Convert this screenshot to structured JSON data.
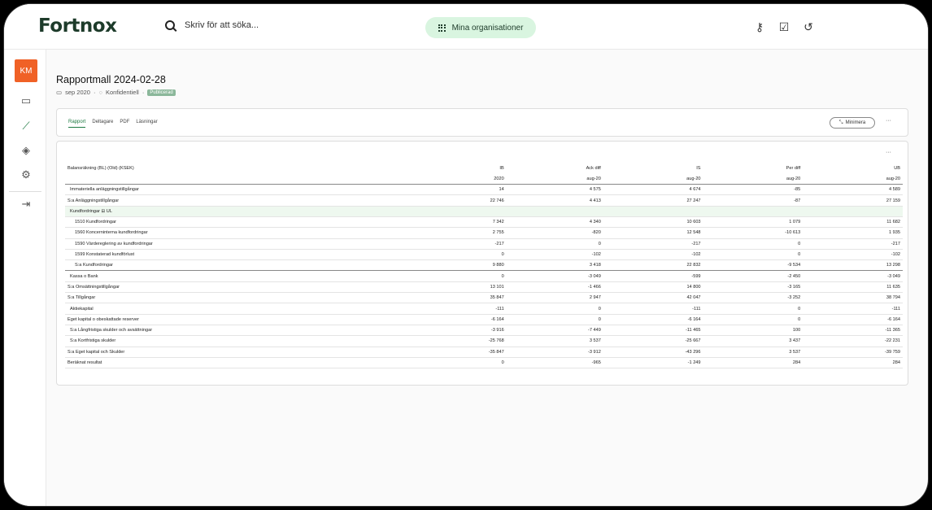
{
  "app": {
    "logo": "Fortnox",
    "search_placeholder": "Skriv för att söka...",
    "org_button": "Mina organisationer"
  },
  "sidebar": {
    "avatar": "KM"
  },
  "page": {
    "title": "Rapportmall 2024-02-28",
    "date": "sep 2020",
    "confidentiality": "Konfidentiell",
    "status": "Publicerad"
  },
  "tabs": [
    "Rapport",
    "Deltagare",
    "PDF",
    "Läsningar"
  ],
  "minimera": "Minimera",
  "table": {
    "columns": [
      "Balansräkning (BL) (Old) (KSEK)",
      "IB",
      "Ack diff",
      "IS",
      "Per diff",
      "UB"
    ],
    "periods": [
      "",
      "2020",
      "aug-20",
      "aug-20",
      "aug-20",
      "aug-20"
    ],
    "rows": [
      {
        "label": "Immateriella anläggningstillgångar",
        "vals": [
          "14",
          "4 575",
          "4 674",
          "-85",
          "4 589"
        ],
        "indent": 1
      },
      {
        "label": "S:a Anläggningstillgångar",
        "vals": [
          "22 746",
          "4 413",
          "27 247",
          "-87",
          "27 159"
        ],
        "indent": 0
      },
      {
        "label": "Kundfordringar ⊟ UL",
        "vals": [
          "",
          "",
          "",
          "",
          ""
        ],
        "indent": 1,
        "hl": true
      },
      {
        "label": "1510 Kundfordringar",
        "vals": [
          "7 342",
          "4 340",
          "10 603",
          "1 079",
          "11 682"
        ],
        "indent": 2
      },
      {
        "label": "1560 Koncerninterna kundfordringar",
        "vals": [
          "2 755",
          "-820",
          "12 548",
          "-10 613",
          "1 935"
        ],
        "indent": 2
      },
      {
        "label": "1590 Värdereglering av kundfordringar",
        "vals": [
          "-217",
          "0",
          "-217",
          "0",
          "-217"
        ],
        "indent": 2
      },
      {
        "label": "1599 Konstaterad kundförlust",
        "vals": [
          "0",
          "-102",
          "-102",
          "0",
          "-102"
        ],
        "indent": 2
      },
      {
        "label": "S:a Kundfordringar",
        "vals": [
          "9 880",
          "3 418",
          "22 832",
          "-9 534",
          "13 298"
        ],
        "indent": 2,
        "strong": true
      },
      {
        "label": "Kassa o Bank",
        "vals": [
          "0",
          "-3 049",
          "-599",
          "-2 450",
          "-3 049"
        ],
        "indent": 1
      },
      {
        "label": "S:a Omsättningstillgångar",
        "vals": [
          "13 101",
          "-1 466",
          "14 800",
          "-3 165",
          "11 635"
        ],
        "indent": 0
      },
      {
        "label": "S:a Tillgångar",
        "vals": [
          "35 847",
          "2 947",
          "42 047",
          "-3 252",
          "38 794"
        ],
        "indent": 0
      },
      {
        "label": "Aktiekapital",
        "vals": [
          "-111",
          "0",
          "-111",
          "0",
          "-111"
        ],
        "indent": 1
      },
      {
        "label": "Eget kapital o obeskattade reserver",
        "vals": [
          "-6 164",
          "0",
          "-6 164",
          "0",
          "-6 164"
        ],
        "indent": 0
      },
      {
        "label": "S:a Långfristiga skulder och avsättningar",
        "vals": [
          "-3 916",
          "-7 449",
          "-11 465",
          "100",
          "-11 365"
        ],
        "indent": 1
      },
      {
        "label": "S:a Kortfristiga skulder",
        "vals": [
          "-25 768",
          "3 537",
          "-25 667",
          "3 437",
          "-22 231"
        ],
        "indent": 1
      },
      {
        "label": "S:a Eget kapital och Skulder",
        "vals": [
          "-35 847",
          "-3 912",
          "-43 296",
          "3 537",
          "-39 759"
        ],
        "indent": 0
      },
      {
        "label": "Beräknat resultat",
        "vals": [
          "0",
          "-965",
          "-1 249",
          "284",
          "284"
        ],
        "indent": 0
      }
    ]
  }
}
